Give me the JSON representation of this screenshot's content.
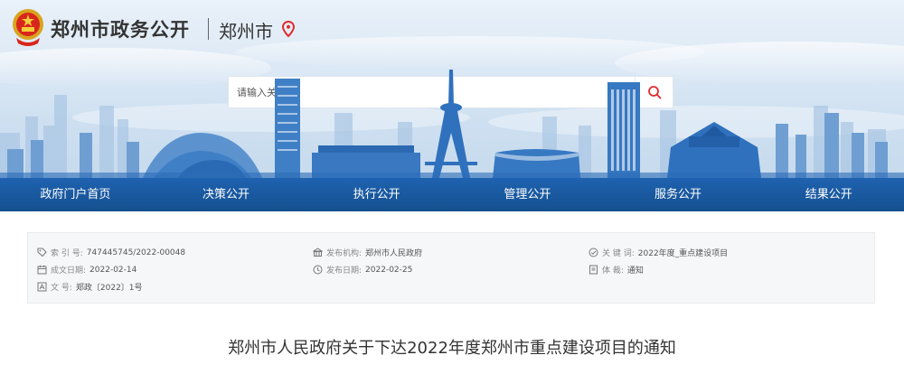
{
  "header": {
    "site_title": "郑州市政务公开",
    "city": "郑州市"
  },
  "search": {
    "placeholder": "请输入关键字"
  },
  "nav": {
    "items": [
      "政府门户首页",
      "决策公开",
      "执行公开",
      "管理公开",
      "服务公开",
      "结果公开"
    ]
  },
  "meta": {
    "index_no": {
      "label": "索 引 号:",
      "value": "747445745/2022-00048"
    },
    "publisher": {
      "label": "发布机构:",
      "value": "郑州市人民政府"
    },
    "keywords": {
      "label": "关  键  词:",
      "value": "2022年度_重点建设项目"
    },
    "created": {
      "label": "成文日期:",
      "value": "2022-02-14"
    },
    "published": {
      "label": "发布日期:",
      "value": "2022-02-25"
    },
    "genre": {
      "label": "体     裁:",
      "value": "通知"
    },
    "doc_no": {
      "label": "文      号:",
      "value": "郑政〔2022〕1号"
    }
  },
  "document": {
    "title": "郑州市人民政府关于下达2022年度郑州市重点建设项目的通知"
  },
  "colors": {
    "nav_bg": "#1a5aa3",
    "accent_red": "#e02c2c",
    "meta_bg": "#f6f7f9"
  },
  "icons": [
    "emblem-icon",
    "location-icon",
    "search-icon",
    "tag-icon",
    "building-icon",
    "check-circle-icon",
    "calendar-icon",
    "clock-icon",
    "document-icon",
    "file-icon"
  ]
}
